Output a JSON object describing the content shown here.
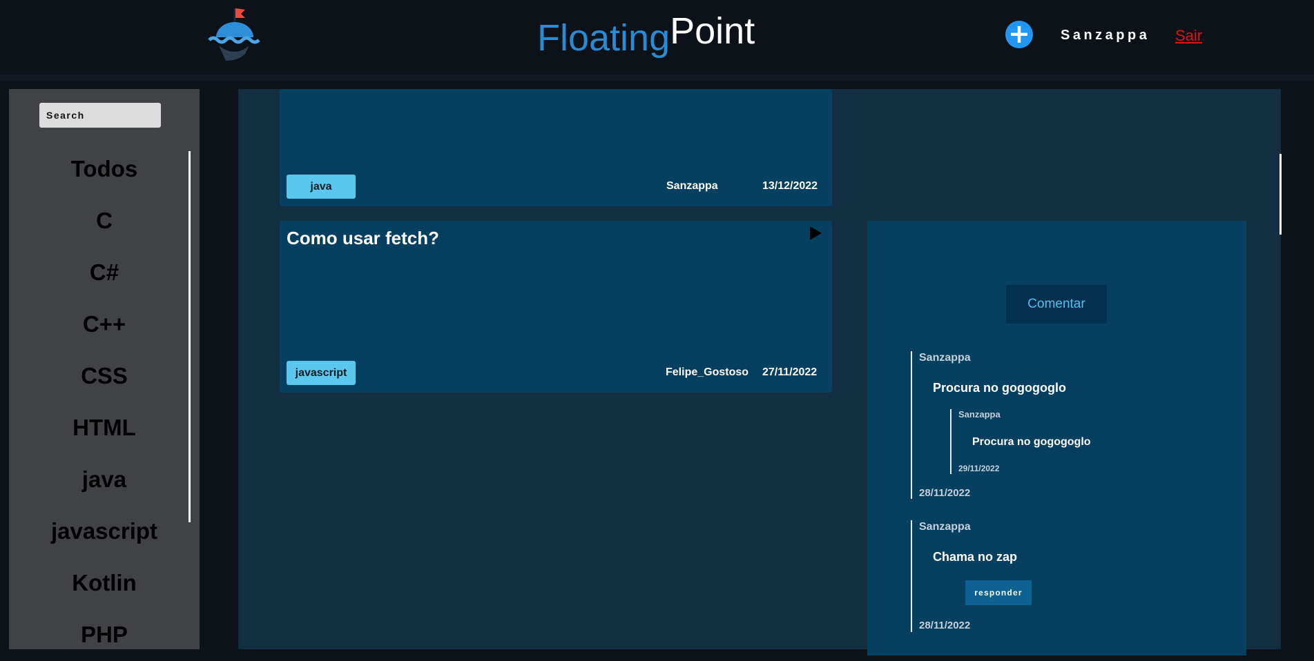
{
  "header": {
    "brand_part1": "Floating",
    "brand_part2": "Point",
    "add_icon": "plus-circle-icon",
    "add_symbol": "+",
    "username": "Sanzappa",
    "logout_label": "Sair",
    "colors": {
      "brand_blue": "#2a8ad2",
      "accent_button": "#2196f3",
      "logout": "#e11414"
    }
  },
  "sidebar": {
    "search_placeholder": "Search",
    "categories": [
      "Todos",
      "C",
      "C#",
      "C++",
      "CSS",
      "HTML",
      "java",
      "javascript",
      "Kotlin",
      "PHP"
    ]
  },
  "posts": [
    {
      "title": "",
      "tag": "java",
      "author": "Sanzappa",
      "date": "13/12/2022"
    },
    {
      "title": "Como usar fetch?",
      "tag": "javascript",
      "author": "Felipe_Gostoso",
      "date": "27/11/2022",
      "expand_icon": "play-icon"
    }
  ],
  "comments": {
    "comment_button": "Comentar",
    "items": [
      {
        "user": "Sanzappa",
        "text": "Procura no gogogoglo",
        "date": "28/11/2022",
        "replies": [
          {
            "user": "Sanzappa",
            "text": "Procura no gogogoglo",
            "date": "29/11/2022"
          }
        ]
      },
      {
        "user": "Sanzappa",
        "text": "Chama no zap",
        "date": "28/11/2022",
        "reply_button": "responder"
      }
    ]
  }
}
